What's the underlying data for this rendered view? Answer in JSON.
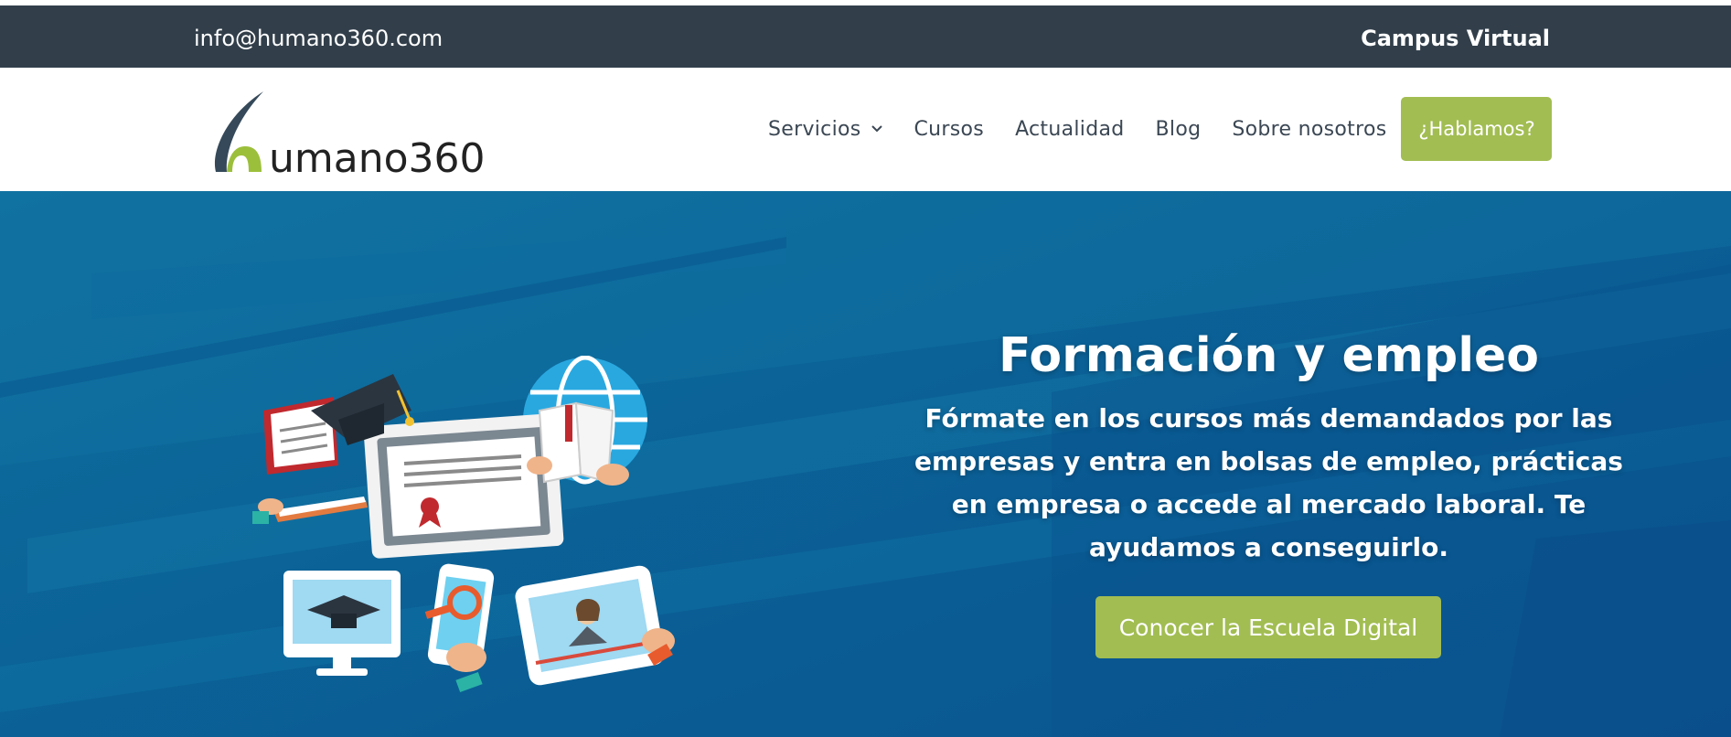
{
  "topbar": {
    "email": "info@humano360.com",
    "campus_label": "Campus Virtual"
  },
  "logo": {
    "text": "umano360",
    "alt": "humano360"
  },
  "nav": {
    "items": [
      {
        "label": "Servicios",
        "has_dropdown": true
      },
      {
        "label": "Cursos"
      },
      {
        "label": "Actualidad"
      },
      {
        "label": "Blog"
      },
      {
        "label": "Sobre nosotros"
      }
    ],
    "cta_label": "¿Hablamos?"
  },
  "hero": {
    "title": "Formación y empleo",
    "description": "Fórmate en los cursos más demandados por las empresas y entra en bolsas de empleo, prácticas en empresa o accede al mercado laboral. Te ayudamos a conseguirlo.",
    "button_label": "Conocer la Escuela Digital"
  },
  "colors": {
    "topbar_bg": "#323f4b",
    "accent_green": "#a2bd52",
    "hero_blue": "#0b6397",
    "nav_text": "#3b4754"
  },
  "icons": [
    "chevron-down-icon",
    "graduation-cap-icon",
    "globe-icon",
    "certificate-icon",
    "monitor-icon",
    "phone-icon",
    "tablet-icon",
    "book-icon",
    "magnifier-icon"
  ]
}
